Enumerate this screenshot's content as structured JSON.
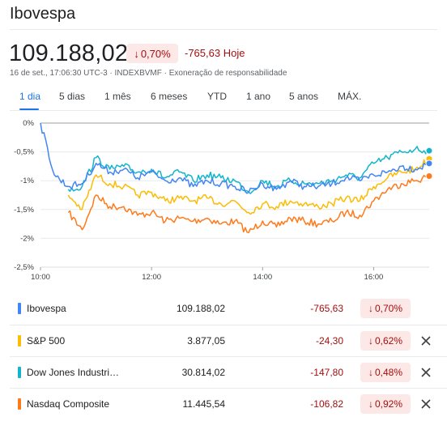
{
  "header": {
    "title": "Ibovespa",
    "price": "109.188,02",
    "change_pct": "0,70%",
    "change_abs": "-765,63 Hoje",
    "meta": "16 de set., 17:06:30 UTC-3 · INDEXBVMF · Exoneração de responsabilidade"
  },
  "tabs": [
    {
      "label": "1 dia",
      "active": true
    },
    {
      "label": "5 dias",
      "active": false
    },
    {
      "label": "1 mês",
      "active": false
    },
    {
      "label": "6 meses",
      "active": false
    },
    {
      "label": "YTD",
      "active": false
    },
    {
      "label": "1 ano",
      "active": false
    },
    {
      "label": "5 anos",
      "active": false
    },
    {
      "label": "MÁX.",
      "active": false
    }
  ],
  "chart_data": {
    "type": "line",
    "y_unit": "%",
    "ylim": [
      -2.5,
      0
    ],
    "y_ticks": [
      "0%",
      "-0,5%",
      "-1%",
      "-1,5%",
      "-2%",
      "-2,5%"
    ],
    "x_ticks": [
      "10:00",
      "12:00",
      "14:00",
      "16:00"
    ],
    "series": [
      {
        "name": "Ibovespa",
        "color": "#4285f4",
        "x": [
          "10:00",
          "10:15",
          "10:30",
          "10:45",
          "11:00",
          "11:15",
          "11:30",
          "11:45",
          "12:00",
          "12:15",
          "12:30",
          "12:45",
          "13:00",
          "13:15",
          "13:30",
          "13:45",
          "14:00",
          "14:15",
          "14:30",
          "14:45",
          "15:00",
          "15:15",
          "15:30",
          "15:45",
          "16:00",
          "16:15",
          "16:30",
          "16:45",
          "17:00"
        ],
        "values": [
          0,
          -0.9,
          -1.1,
          -1.05,
          -0.7,
          -0.85,
          -0.8,
          -0.95,
          -0.85,
          -1.0,
          -0.95,
          -1.1,
          -1.0,
          -1.05,
          -1.1,
          -1.2,
          -1.05,
          -1.15,
          -1.0,
          -1.1,
          -1.1,
          -1.05,
          -0.95,
          -1.0,
          -0.9,
          -0.85,
          -0.75,
          -0.8,
          -0.7
        ]
      },
      {
        "name": "S&P 500",
        "color": "#fbbc04",
        "x": [
          "10:00",
          "10:15",
          "10:30",
          "10:45",
          "11:00",
          "11:15",
          "11:30",
          "11:45",
          "12:00",
          "12:15",
          "12:30",
          "12:45",
          "13:00",
          "13:15",
          "13:30",
          "13:45",
          "14:00",
          "14:15",
          "14:30",
          "14:45",
          "15:00",
          "15:15",
          "15:30",
          "15:45",
          "16:00",
          "16:15",
          "16:30",
          "16:45",
          "17:00"
        ],
        "values": [
          null,
          null,
          -1.25,
          -1.5,
          -0.9,
          -1.05,
          -1.1,
          -1.25,
          -1.2,
          -1.35,
          -1.3,
          -1.35,
          -1.3,
          -1.4,
          -1.35,
          -1.55,
          -1.4,
          -1.45,
          -1.35,
          -1.4,
          -1.45,
          -1.4,
          -1.3,
          -1.35,
          -1.1,
          -0.95,
          -0.85,
          -0.8,
          -0.62
        ]
      },
      {
        "name": "Dow Jones Industri…",
        "color": "#12b5cb",
        "x": [
          "10:00",
          "10:15",
          "10:30",
          "10:45",
          "11:00",
          "11:15",
          "11:30",
          "11:45",
          "12:00",
          "12:15",
          "12:30",
          "12:45",
          "13:00",
          "13:15",
          "13:30",
          "13:45",
          "14:00",
          "14:15",
          "14:30",
          "14:45",
          "15:00",
          "15:15",
          "15:30",
          "15:45",
          "16:00",
          "16:15",
          "16:30",
          "16:45",
          "17:00"
        ],
        "values": [
          null,
          null,
          -1.15,
          -1.1,
          -0.6,
          -0.8,
          -0.75,
          -0.85,
          -0.8,
          -0.95,
          -0.85,
          -1.0,
          -0.9,
          -0.95,
          -1.0,
          -1.2,
          -1.0,
          -1.1,
          -1.0,
          -1.05,
          -1.05,
          -1.0,
          -0.9,
          -0.95,
          -0.7,
          -0.6,
          -0.5,
          -0.45,
          -0.48
        ]
      },
      {
        "name": "Nasdaq Composite",
        "color": "#ff7a1a",
        "x": [
          "10:00",
          "10:15",
          "10:30",
          "10:45",
          "11:00",
          "11:15",
          "11:30",
          "11:45",
          "12:00",
          "12:15",
          "12:30",
          "12:45",
          "13:00",
          "13:15",
          "13:30",
          "13:45",
          "14:00",
          "14:15",
          "14:30",
          "14:45",
          "15:00",
          "15:15",
          "15:30",
          "15:45",
          "16:00",
          "16:15",
          "16:30",
          "16:45",
          "17:00"
        ],
        "values": [
          null,
          null,
          -1.55,
          -1.85,
          -1.25,
          -1.45,
          -1.45,
          -1.6,
          -1.55,
          -1.7,
          -1.65,
          -1.7,
          -1.65,
          -1.75,
          -1.7,
          -1.9,
          -1.7,
          -1.8,
          -1.65,
          -1.7,
          -1.75,
          -1.7,
          -1.55,
          -1.6,
          -1.35,
          -1.15,
          -1.05,
          -1.0,
          -0.92
        ]
      }
    ]
  },
  "rows": [
    {
      "name": "Ibovespa",
      "value": "109.188,02",
      "abs": "-765,63",
      "pct": "0,70%",
      "color": "#4285f4",
      "removable": false
    },
    {
      "name": "S&P 500",
      "value": "3.877,05",
      "abs": "-24,30",
      "pct": "0,62%",
      "color": "#fbbc04",
      "removable": true
    },
    {
      "name": "Dow Jones Industri…",
      "value": "30.814,02",
      "abs": "-147,80",
      "pct": "0,48%",
      "color": "#12b5cb",
      "removable": true
    },
    {
      "name": "Nasdaq Composite",
      "value": "11.445,54",
      "abs": "-106,82",
      "pct": "0,92%",
      "color": "#ff7a1a",
      "removable": true
    }
  ],
  "icons": {
    "down_arrow": "arrow-down-icon",
    "close": "close-icon"
  }
}
